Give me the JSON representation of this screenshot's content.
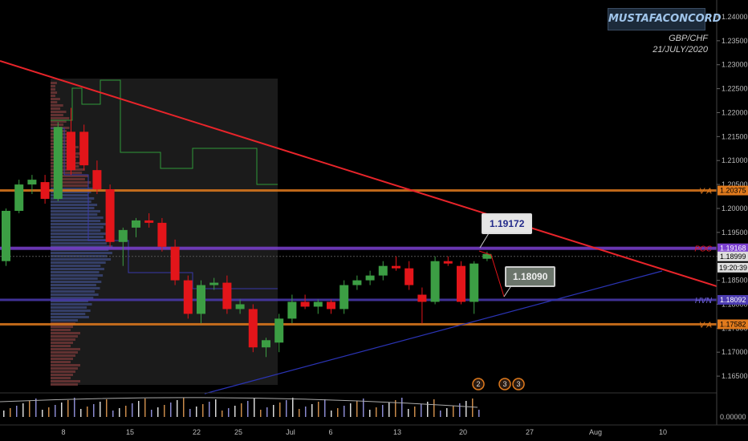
{
  "header": {
    "brand": "MUSTAFACONCORD",
    "pair": "GBP/CHF",
    "date": "21/JULY/2020"
  },
  "colors": {
    "bull": "#3c9e44",
    "bear": "#e3151a",
    "trend_down": "#e8242a",
    "trend_up": "#2b34b5",
    "poc": "#7b3fd0",
    "hvn": "#4b3bb0",
    "va": "#e07a1d",
    "profile_box": "#1b1b1b"
  },
  "callouts": {
    "upper": "1.19172",
    "lower": "1.18090"
  },
  "levels": {
    "va_high": {
      "label": "V A",
      "value": "1.20375"
    },
    "poc": {
      "label": "POC",
      "value": "1.19168"
    },
    "hvn": {
      "label": "HVN",
      "value": "1.18092"
    },
    "va_low": {
      "label": "V A",
      "value": "1.17582"
    },
    "last_price": "1.18999",
    "countdown": "19:20:39"
  },
  "volume_label": "0.00000",
  "event_markers": [
    "2",
    "3",
    "3"
  ],
  "chart_data": {
    "type": "candlestick",
    "ylim": [
      1.1615,
      1.2415
    ],
    "yticks": [
      "1.24000",
      "1.23500",
      "1.23000",
      "1.22500",
      "1.22000",
      "1.21500",
      "1.21000",
      "1.20500",
      "1.20000",
      "1.19500",
      "1.19000",
      "1.18500",
      "1.18000",
      "1.17500",
      "1.17000",
      "1.16500"
    ],
    "xticks": [
      "8",
      "15",
      "22",
      "25",
      "Jul",
      "6",
      "13",
      "20",
      "27",
      "Aug",
      "10"
    ],
    "candles": [
      {
        "o": 1.189,
        "h": 1.2,
        "l": 1.188,
        "c": 1.1995
      },
      {
        "o": 1.1995,
        "h": 1.206,
        "l": 1.199,
        "c": 1.205
      },
      {
        "o": 1.205,
        "h": 1.207,
        "l": 1.203,
        "c": 1.206
      },
      {
        "o": 1.2055,
        "h": 1.207,
        "l": 1.201,
        "c": 1.202
      },
      {
        "o": 1.202,
        "h": 1.218,
        "l": 1.2015,
        "c": 1.217
      },
      {
        "o": 1.216,
        "h": 1.221,
        "l": 1.207,
        "c": 1.208
      },
      {
        "o": 1.216,
        "h": 1.2175,
        "l": 1.208,
        "c": 1.209
      },
      {
        "o": 1.208,
        "h": 1.21,
        "l": 1.203,
        "c": 1.204
      },
      {
        "o": 1.204,
        "h": 1.205,
        "l": 1.192,
        "c": 1.193
      },
      {
        "o": 1.193,
        "h": 1.196,
        "l": 1.188,
        "c": 1.1955
      },
      {
        "o": 1.196,
        "h": 1.198,
        "l": 1.194,
        "c": 1.1975
      },
      {
        "o": 1.1975,
        "h": 1.199,
        "l": 1.196,
        "c": 1.197
      },
      {
        "o": 1.197,
        "h": 1.198,
        "l": 1.191,
        "c": 1.192
      },
      {
        "o": 1.192,
        "h": 1.1935,
        "l": 1.184,
        "c": 1.185
      },
      {
        "o": 1.185,
        "h": 1.186,
        "l": 1.177,
        "c": 1.178
      },
      {
        "o": 1.178,
        "h": 1.185,
        "l": 1.176,
        "c": 1.184
      },
      {
        "o": 1.184,
        "h": 1.1855,
        "l": 1.183,
        "c": 1.1845
      },
      {
        "o": 1.1845,
        "h": 1.186,
        "l": 1.178,
        "c": 1.179
      },
      {
        "o": 1.179,
        "h": 1.181,
        "l": 1.178,
        "c": 1.18
      },
      {
        "o": 1.179,
        "h": 1.18,
        "l": 1.17,
        "c": 1.171
      },
      {
        "o": 1.171,
        "h": 1.173,
        "l": 1.169,
        "c": 1.1725
      },
      {
        "o": 1.172,
        "h": 1.178,
        "l": 1.17,
        "c": 1.177
      },
      {
        "o": 1.177,
        "h": 1.182,
        "l": 1.176,
        "c": 1.1805
      },
      {
        "o": 1.1805,
        "h": 1.182,
        "l": 1.179,
        "c": 1.1795
      },
      {
        "o": 1.1795,
        "h": 1.181,
        "l": 1.178,
        "c": 1.1805
      },
      {
        "o": 1.1805,
        "h": 1.181,
        "l": 1.178,
        "c": 1.179
      },
      {
        "o": 1.179,
        "h": 1.185,
        "l": 1.178,
        "c": 1.184
      },
      {
        "o": 1.184,
        "h": 1.186,
        "l": 1.183,
        "c": 1.185
      },
      {
        "o": 1.185,
        "h": 1.187,
        "l": 1.184,
        "c": 1.186
      },
      {
        "o": 1.186,
        "h": 1.189,
        "l": 1.185,
        "c": 1.188
      },
      {
        "o": 1.188,
        "h": 1.19,
        "l": 1.187,
        "c": 1.1875
      },
      {
        "o": 1.1875,
        "h": 1.189,
        "l": 1.183,
        "c": 1.184
      },
      {
        "o": 1.182,
        "h": 1.1835,
        "l": 1.176,
        "c": 1.1805
      },
      {
        "o": 1.1805,
        "h": 1.19,
        "l": 1.18,
        "c": 1.189
      },
      {
        "o": 1.189,
        "h": 1.19,
        "l": 1.188,
        "c": 1.1885
      },
      {
        "o": 1.188,
        "h": 1.189,
        "l": 1.18,
        "c": 1.1805
      },
      {
        "o": 1.1805,
        "h": 1.189,
        "l": 1.178,
        "c": 1.1885
      },
      {
        "o": 1.1895,
        "h": 1.191,
        "l": 1.189,
        "c": 1.1905
      }
    ]
  }
}
